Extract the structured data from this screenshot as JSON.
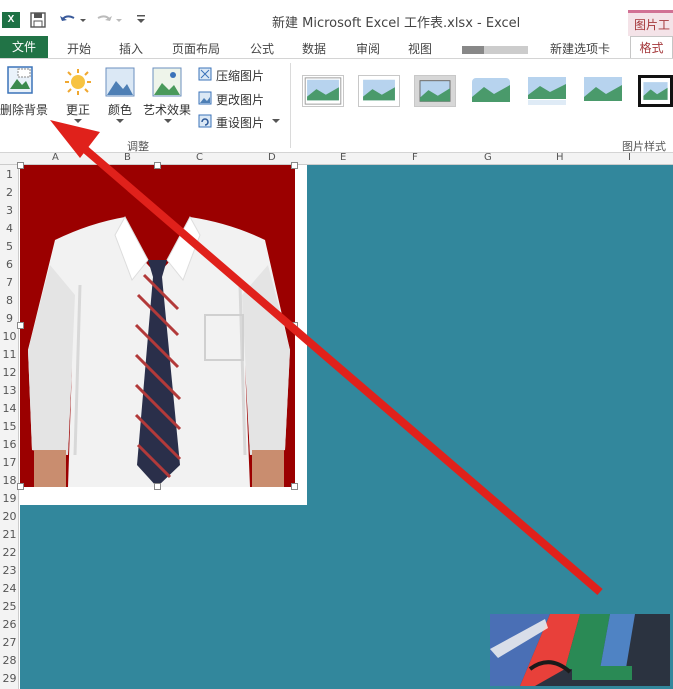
{
  "app": {
    "title": "新建 Microsoft Excel 工作表.xlsx - Excel",
    "context_tab_group": "图片工具"
  },
  "quick_access": {
    "logo": "X",
    "save_icon": "save-icon",
    "undo_icon": "undo-icon",
    "redo_icon": "redo-icon"
  },
  "tabs": {
    "file": "文件",
    "items": [
      "开始",
      "插入",
      "页面布局",
      "公式",
      "数据",
      "审阅",
      "视图",
      "新建选项卡"
    ],
    "active": "格式"
  },
  "ribbon": {
    "remove_bg": "删除背景",
    "corrections": "更正",
    "color": "颜色",
    "artistic": "艺术效果",
    "compress": "压缩图片",
    "change": "更改图片",
    "reset": "重设图片",
    "group_adjust": "调整",
    "group_styles": "图片样式"
  },
  "sheet": {
    "columns": [
      "A",
      "B",
      "C",
      "D",
      "E",
      "F",
      "G",
      "H",
      "I"
    ],
    "rows": [
      "1",
      "2",
      "3",
      "4",
      "5",
      "6",
      "7",
      "8",
      "9",
      "10",
      "11",
      "12",
      "13",
      "14",
      "15",
      "16",
      "17",
      "18",
      "19",
      "20",
      "21",
      "22",
      "23",
      "24",
      "25",
      "26",
      "27",
      "28",
      "29"
    ]
  },
  "colors": {
    "teal_background": "#32879c",
    "photo_background": "#9b0000",
    "file_tab": "#217346",
    "arrow": "#e0211b"
  }
}
